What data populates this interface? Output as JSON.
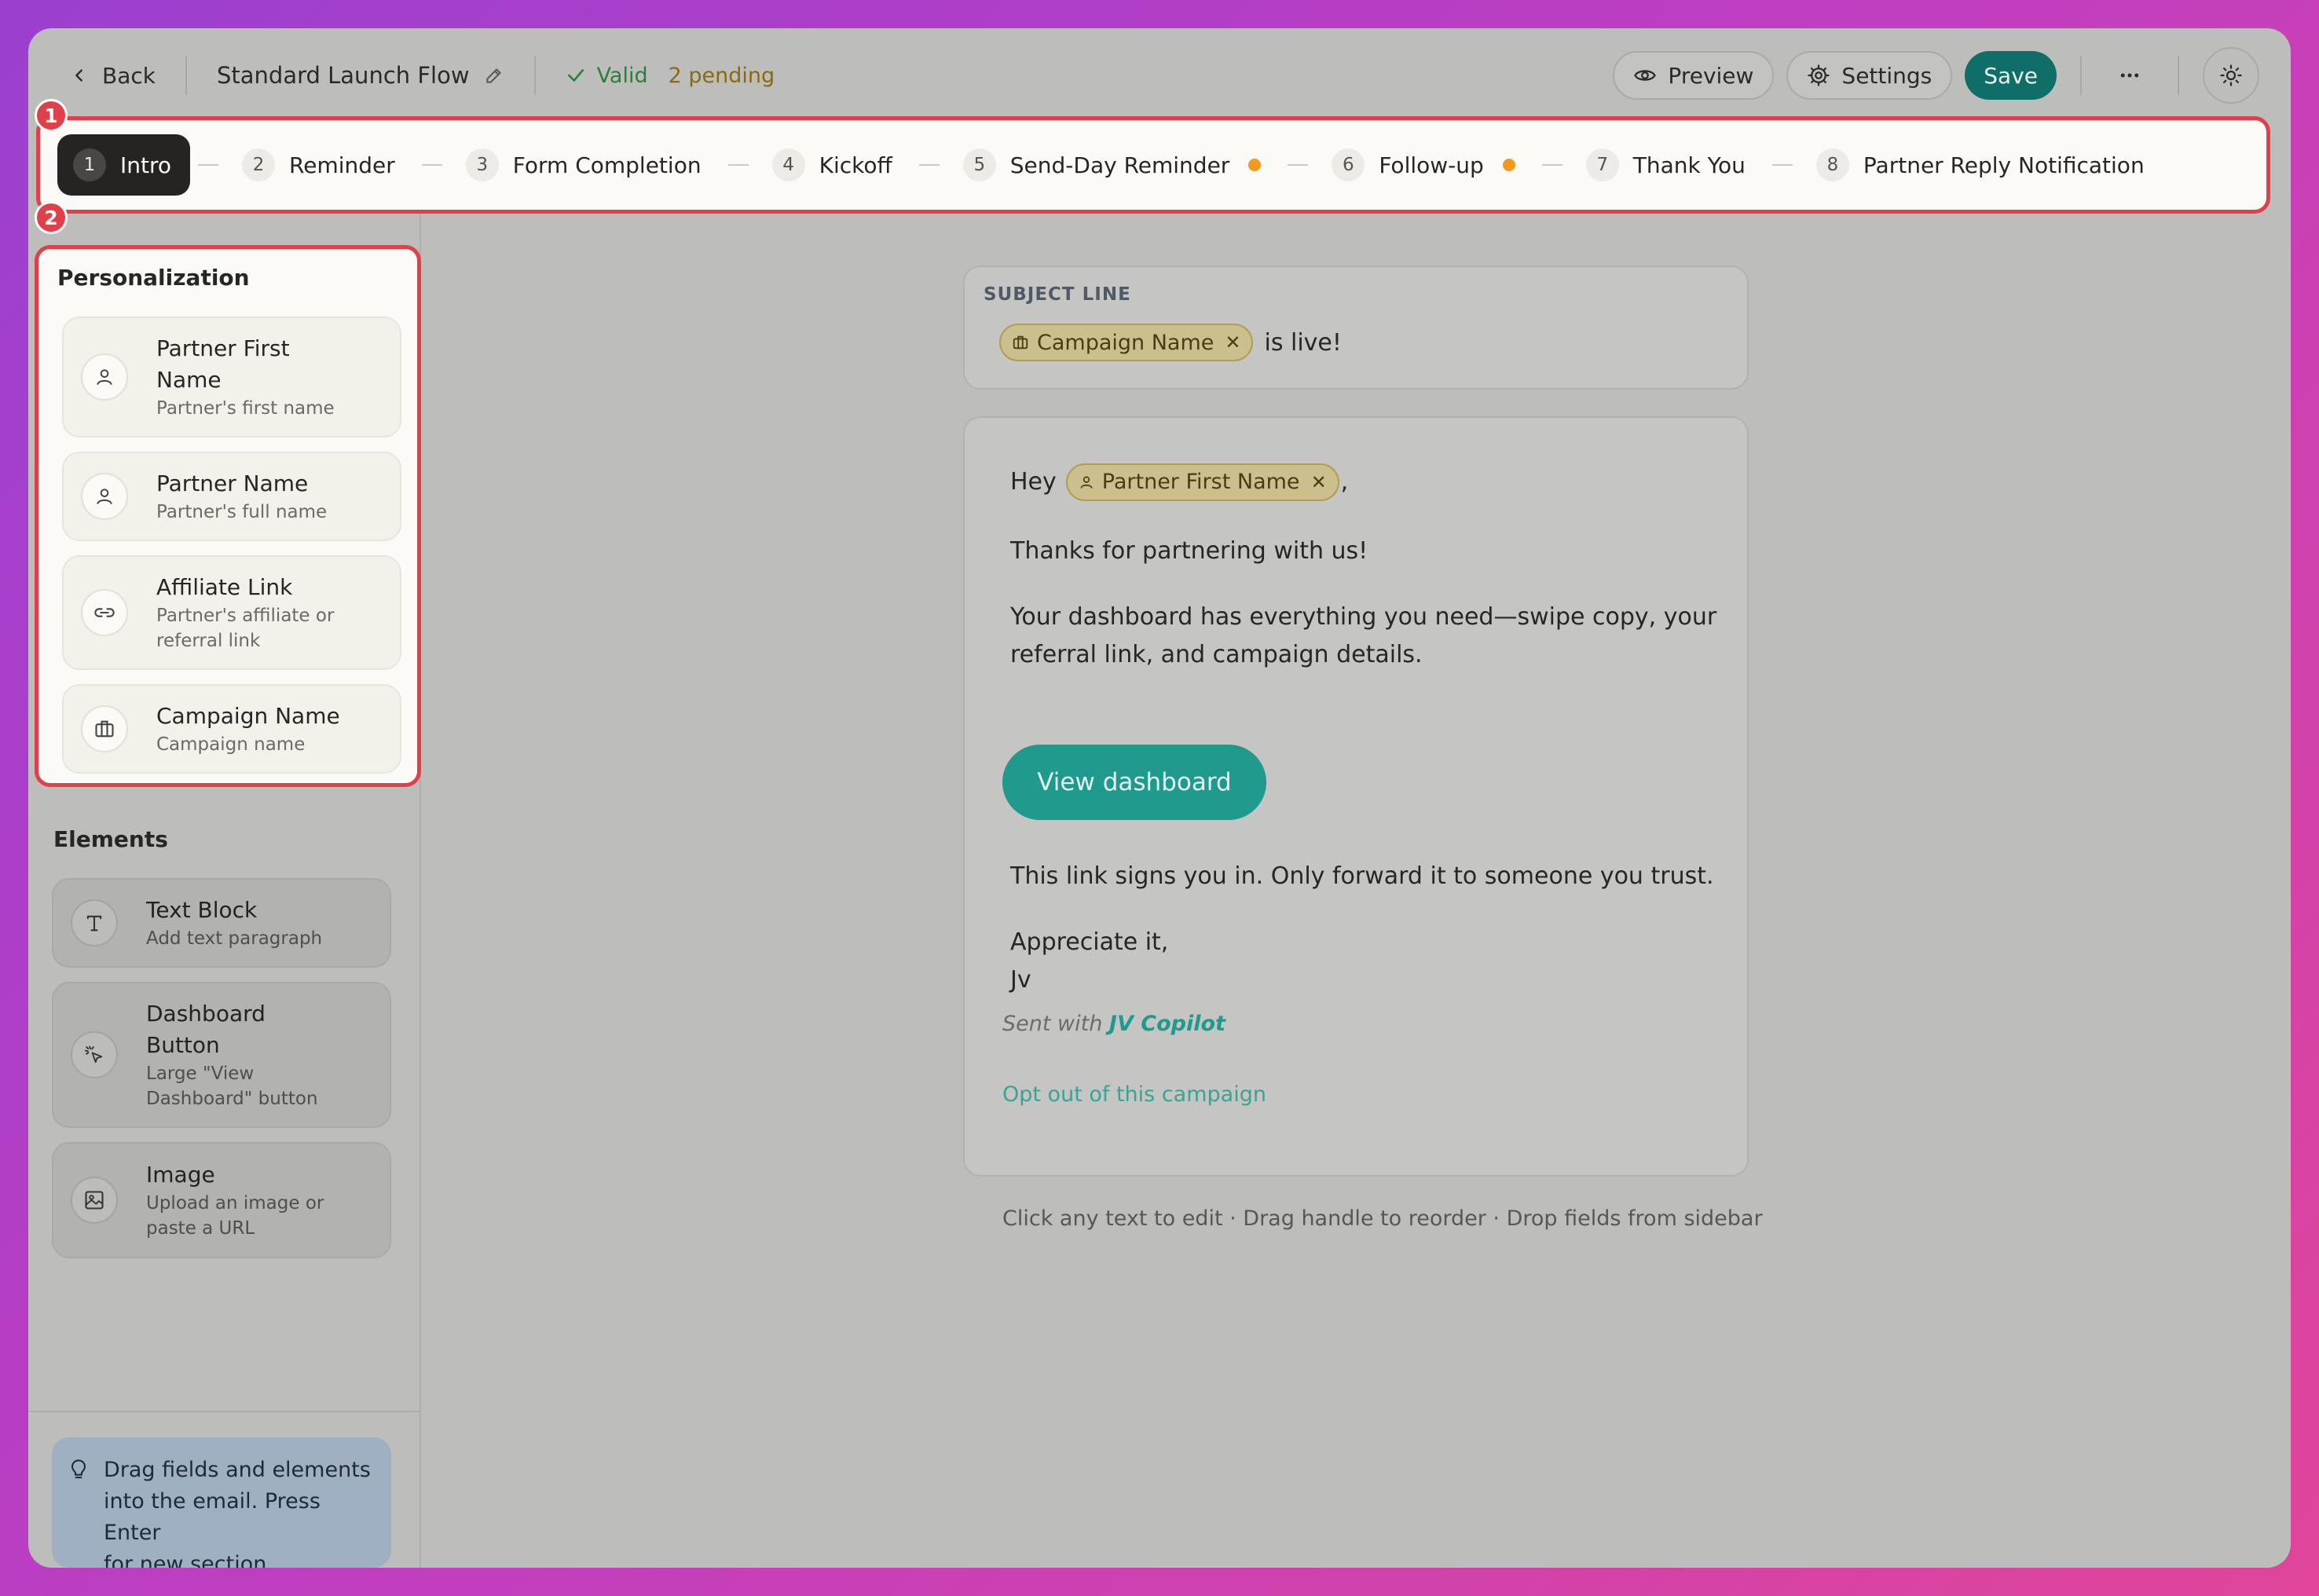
{
  "topbar": {
    "back_label": "Back",
    "flow_title": "Standard Launch Flow",
    "valid_label": "Valid",
    "pending_label": "2 pending",
    "preview_label": "Preview",
    "settings_label": "Settings",
    "save_label": "Save"
  },
  "badges": {
    "steps": "1",
    "personalization": "2"
  },
  "steps": [
    {
      "num": "1",
      "label": "Intro",
      "active": true
    },
    {
      "num": "2",
      "label": "Reminder"
    },
    {
      "num": "3",
      "label": "Form Completion"
    },
    {
      "num": "4",
      "label": "Kickoff"
    },
    {
      "num": "5",
      "label": "Send-Day Reminder",
      "pending": true
    },
    {
      "num": "6",
      "label": "Follow-up",
      "pending": true
    },
    {
      "num": "7",
      "label": "Thank You"
    },
    {
      "num": "8",
      "label": "Partner Reply Notification"
    }
  ],
  "personalization": {
    "title": "Personalization",
    "fields": [
      {
        "name_1": "Partner First",
        "name_2": "Name",
        "desc": "Partner's first name",
        "icon": "user-icon"
      },
      {
        "name": "Partner Name",
        "desc": "Partner's full name",
        "icon": "user-icon"
      },
      {
        "name": "Affiliate Link",
        "desc_1": "Partner's affiliate or",
        "desc_2": "referral link",
        "icon": "link-icon"
      },
      {
        "name": "Campaign Name",
        "desc": "Campaign name",
        "icon": "briefcase-icon"
      }
    ]
  },
  "elements": {
    "title": "Elements",
    "items": [
      {
        "name": "Text Block",
        "desc": "Add text paragraph",
        "icon": "text-icon"
      },
      {
        "name_1": "Dashboard",
        "name_2": "Button",
        "desc_1": "Large \"View",
        "desc_2": "Dashboard\" button",
        "icon": "pointer-click-icon"
      },
      {
        "name": "Image",
        "desc_1": "Upload an image or",
        "desc_2": "paste a URL",
        "icon": "image-icon"
      }
    ]
  },
  "tip": {
    "line1": "Drag fields and elements",
    "line2": "into the email. Press Enter",
    "line3": "for new section"
  },
  "subject": {
    "label": "SUBJECT LINE",
    "chip": "Campaign Name",
    "suffix": "is live!"
  },
  "email": {
    "greeting": "Hey",
    "greeting_chip": "Partner First Name",
    "greeting_punct": ",",
    "line1": "Thanks for partnering with us!",
    "para_a": "Your dashboard has everything you need—swipe copy, your",
    "para_b": "referral link, and campaign details.",
    "button": "View dashboard",
    "warning": "This link signs you in. Only forward it to someone you trust.",
    "signoff": "Appreciate it,",
    "signature": "Jv",
    "sent_prefix": "Sent with",
    "sent_brand": "JV Copilot",
    "optout": "Opt out of this campaign"
  },
  "help_text": "Click any text to edit · Drag handle to reorder · Drop fields from sidebar"
}
